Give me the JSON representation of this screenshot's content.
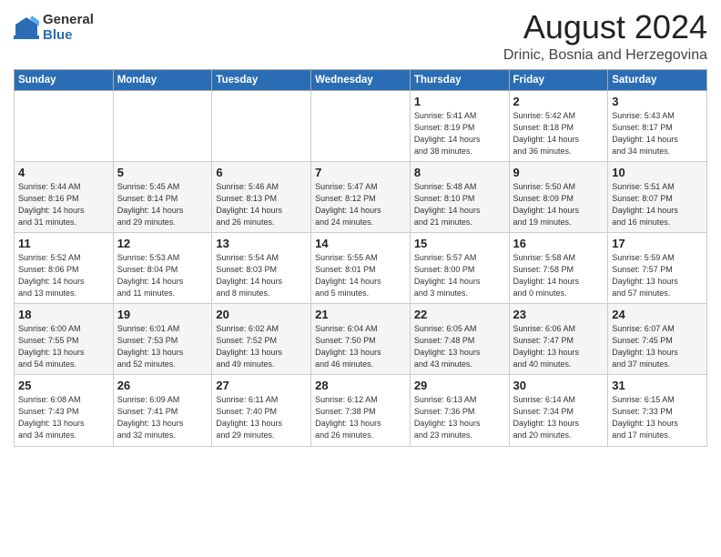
{
  "logo": {
    "general": "General",
    "blue": "Blue"
  },
  "title": "August 2024",
  "location": "Drinic, Bosnia and Herzegovina",
  "days_of_week": [
    "Sunday",
    "Monday",
    "Tuesday",
    "Wednesday",
    "Thursday",
    "Friday",
    "Saturday"
  ],
  "weeks": [
    [
      {
        "day": "",
        "info": ""
      },
      {
        "day": "",
        "info": ""
      },
      {
        "day": "",
        "info": ""
      },
      {
        "day": "",
        "info": ""
      },
      {
        "day": "1",
        "info": "Sunrise: 5:41 AM\nSunset: 8:19 PM\nDaylight: 14 hours\nand 38 minutes."
      },
      {
        "day": "2",
        "info": "Sunrise: 5:42 AM\nSunset: 8:18 PM\nDaylight: 14 hours\nand 36 minutes."
      },
      {
        "day": "3",
        "info": "Sunrise: 5:43 AM\nSunset: 8:17 PM\nDaylight: 14 hours\nand 34 minutes."
      }
    ],
    [
      {
        "day": "4",
        "info": "Sunrise: 5:44 AM\nSunset: 8:16 PM\nDaylight: 14 hours\nand 31 minutes."
      },
      {
        "day": "5",
        "info": "Sunrise: 5:45 AM\nSunset: 8:14 PM\nDaylight: 14 hours\nand 29 minutes."
      },
      {
        "day": "6",
        "info": "Sunrise: 5:46 AM\nSunset: 8:13 PM\nDaylight: 14 hours\nand 26 minutes."
      },
      {
        "day": "7",
        "info": "Sunrise: 5:47 AM\nSunset: 8:12 PM\nDaylight: 14 hours\nand 24 minutes."
      },
      {
        "day": "8",
        "info": "Sunrise: 5:48 AM\nSunset: 8:10 PM\nDaylight: 14 hours\nand 21 minutes."
      },
      {
        "day": "9",
        "info": "Sunrise: 5:50 AM\nSunset: 8:09 PM\nDaylight: 14 hours\nand 19 minutes."
      },
      {
        "day": "10",
        "info": "Sunrise: 5:51 AM\nSunset: 8:07 PM\nDaylight: 14 hours\nand 16 minutes."
      }
    ],
    [
      {
        "day": "11",
        "info": "Sunrise: 5:52 AM\nSunset: 8:06 PM\nDaylight: 14 hours\nand 13 minutes."
      },
      {
        "day": "12",
        "info": "Sunrise: 5:53 AM\nSunset: 8:04 PM\nDaylight: 14 hours\nand 11 minutes."
      },
      {
        "day": "13",
        "info": "Sunrise: 5:54 AM\nSunset: 8:03 PM\nDaylight: 14 hours\nand 8 minutes."
      },
      {
        "day": "14",
        "info": "Sunrise: 5:55 AM\nSunset: 8:01 PM\nDaylight: 14 hours\nand 5 minutes."
      },
      {
        "day": "15",
        "info": "Sunrise: 5:57 AM\nSunset: 8:00 PM\nDaylight: 14 hours\nand 3 minutes."
      },
      {
        "day": "16",
        "info": "Sunrise: 5:58 AM\nSunset: 7:58 PM\nDaylight: 14 hours\nand 0 minutes."
      },
      {
        "day": "17",
        "info": "Sunrise: 5:59 AM\nSunset: 7:57 PM\nDaylight: 13 hours\nand 57 minutes."
      }
    ],
    [
      {
        "day": "18",
        "info": "Sunrise: 6:00 AM\nSunset: 7:55 PM\nDaylight: 13 hours\nand 54 minutes."
      },
      {
        "day": "19",
        "info": "Sunrise: 6:01 AM\nSunset: 7:53 PM\nDaylight: 13 hours\nand 52 minutes."
      },
      {
        "day": "20",
        "info": "Sunrise: 6:02 AM\nSunset: 7:52 PM\nDaylight: 13 hours\nand 49 minutes."
      },
      {
        "day": "21",
        "info": "Sunrise: 6:04 AM\nSunset: 7:50 PM\nDaylight: 13 hours\nand 46 minutes."
      },
      {
        "day": "22",
        "info": "Sunrise: 6:05 AM\nSunset: 7:48 PM\nDaylight: 13 hours\nand 43 minutes."
      },
      {
        "day": "23",
        "info": "Sunrise: 6:06 AM\nSunset: 7:47 PM\nDaylight: 13 hours\nand 40 minutes."
      },
      {
        "day": "24",
        "info": "Sunrise: 6:07 AM\nSunset: 7:45 PM\nDaylight: 13 hours\nand 37 minutes."
      }
    ],
    [
      {
        "day": "25",
        "info": "Sunrise: 6:08 AM\nSunset: 7:43 PM\nDaylight: 13 hours\nand 34 minutes."
      },
      {
        "day": "26",
        "info": "Sunrise: 6:09 AM\nSunset: 7:41 PM\nDaylight: 13 hours\nand 32 minutes."
      },
      {
        "day": "27",
        "info": "Sunrise: 6:11 AM\nSunset: 7:40 PM\nDaylight: 13 hours\nand 29 minutes."
      },
      {
        "day": "28",
        "info": "Sunrise: 6:12 AM\nSunset: 7:38 PM\nDaylight: 13 hours\nand 26 minutes."
      },
      {
        "day": "29",
        "info": "Sunrise: 6:13 AM\nSunset: 7:36 PM\nDaylight: 13 hours\nand 23 minutes."
      },
      {
        "day": "30",
        "info": "Sunrise: 6:14 AM\nSunset: 7:34 PM\nDaylight: 13 hours\nand 20 minutes."
      },
      {
        "day": "31",
        "info": "Sunrise: 6:15 AM\nSunset: 7:33 PM\nDaylight: 13 hours\nand 17 minutes."
      }
    ]
  ]
}
